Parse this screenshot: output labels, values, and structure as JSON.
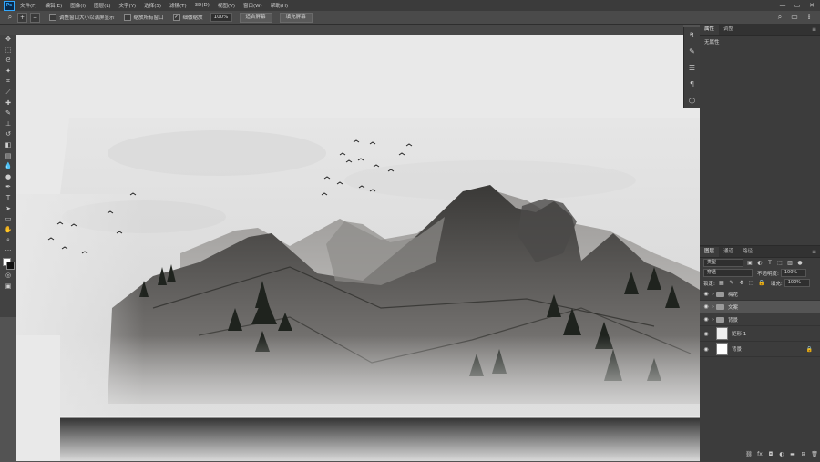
{
  "app": {
    "logo": "Ps"
  },
  "menu": [
    "文件(F)",
    "编辑(E)",
    "图像(I)",
    "图层(L)",
    "文字(Y)",
    "选择(S)",
    "滤镜(T)",
    "3D(D)",
    "视图(V)",
    "窗口(W)",
    "帮助(H)"
  ],
  "window_controls": {
    "minimize": "—",
    "maximize": "▭",
    "close": "✕"
  },
  "options_bar": {
    "tool_icon": "zoom-icon",
    "checkbox1_label": "调整窗口大小以满屏显示",
    "checkbox2_label": "缩放所有窗口",
    "checkbox3_label": "细微缩放",
    "checkbox3_checked": true,
    "zoom_value": "100%",
    "fit_screen_label": "适合屏幕",
    "fill_screen_label": "填充屏幕"
  },
  "tools": [
    "move-icon",
    "marquee-icon",
    "lasso-icon",
    "magic-wand-icon",
    "crop-icon",
    "eyedropper-icon",
    "healing-icon",
    "brush-icon",
    "stamp-icon",
    "history-brush-icon",
    "eraser-icon",
    "gradient-icon",
    "blur-icon",
    "dodge-icon",
    "pen-icon",
    "type-icon",
    "path-select-icon",
    "shape-icon",
    "hand-icon",
    "zoom-icon"
  ],
  "properties_panel": {
    "tabs": [
      "属性",
      "调整"
    ],
    "body_text": "无属性"
  },
  "layers_panel": {
    "tabs": [
      "图层",
      "通道",
      "路径"
    ],
    "filter_kind": "类型",
    "blend_mode": "穿透",
    "opacity_label": "不透明度:",
    "opacity_value": "100%",
    "lock_label": "锁定:",
    "fill_label": "填充:",
    "fill_value": "100%",
    "layers": [
      {
        "name": "梅花",
        "type": "group",
        "selected": false
      },
      {
        "name": "文案",
        "type": "group",
        "selected": true
      },
      {
        "name": "背景",
        "type": "group",
        "selected": false
      },
      {
        "name": "矩形 1",
        "type": "shape",
        "selected": false
      },
      {
        "name": "背景",
        "type": "background",
        "selected": false
      }
    ]
  },
  "colors": {
    "ui_dark": "#3c3c3c",
    "canvas": "#e9e9e9",
    "accent": "#31a8ff"
  }
}
